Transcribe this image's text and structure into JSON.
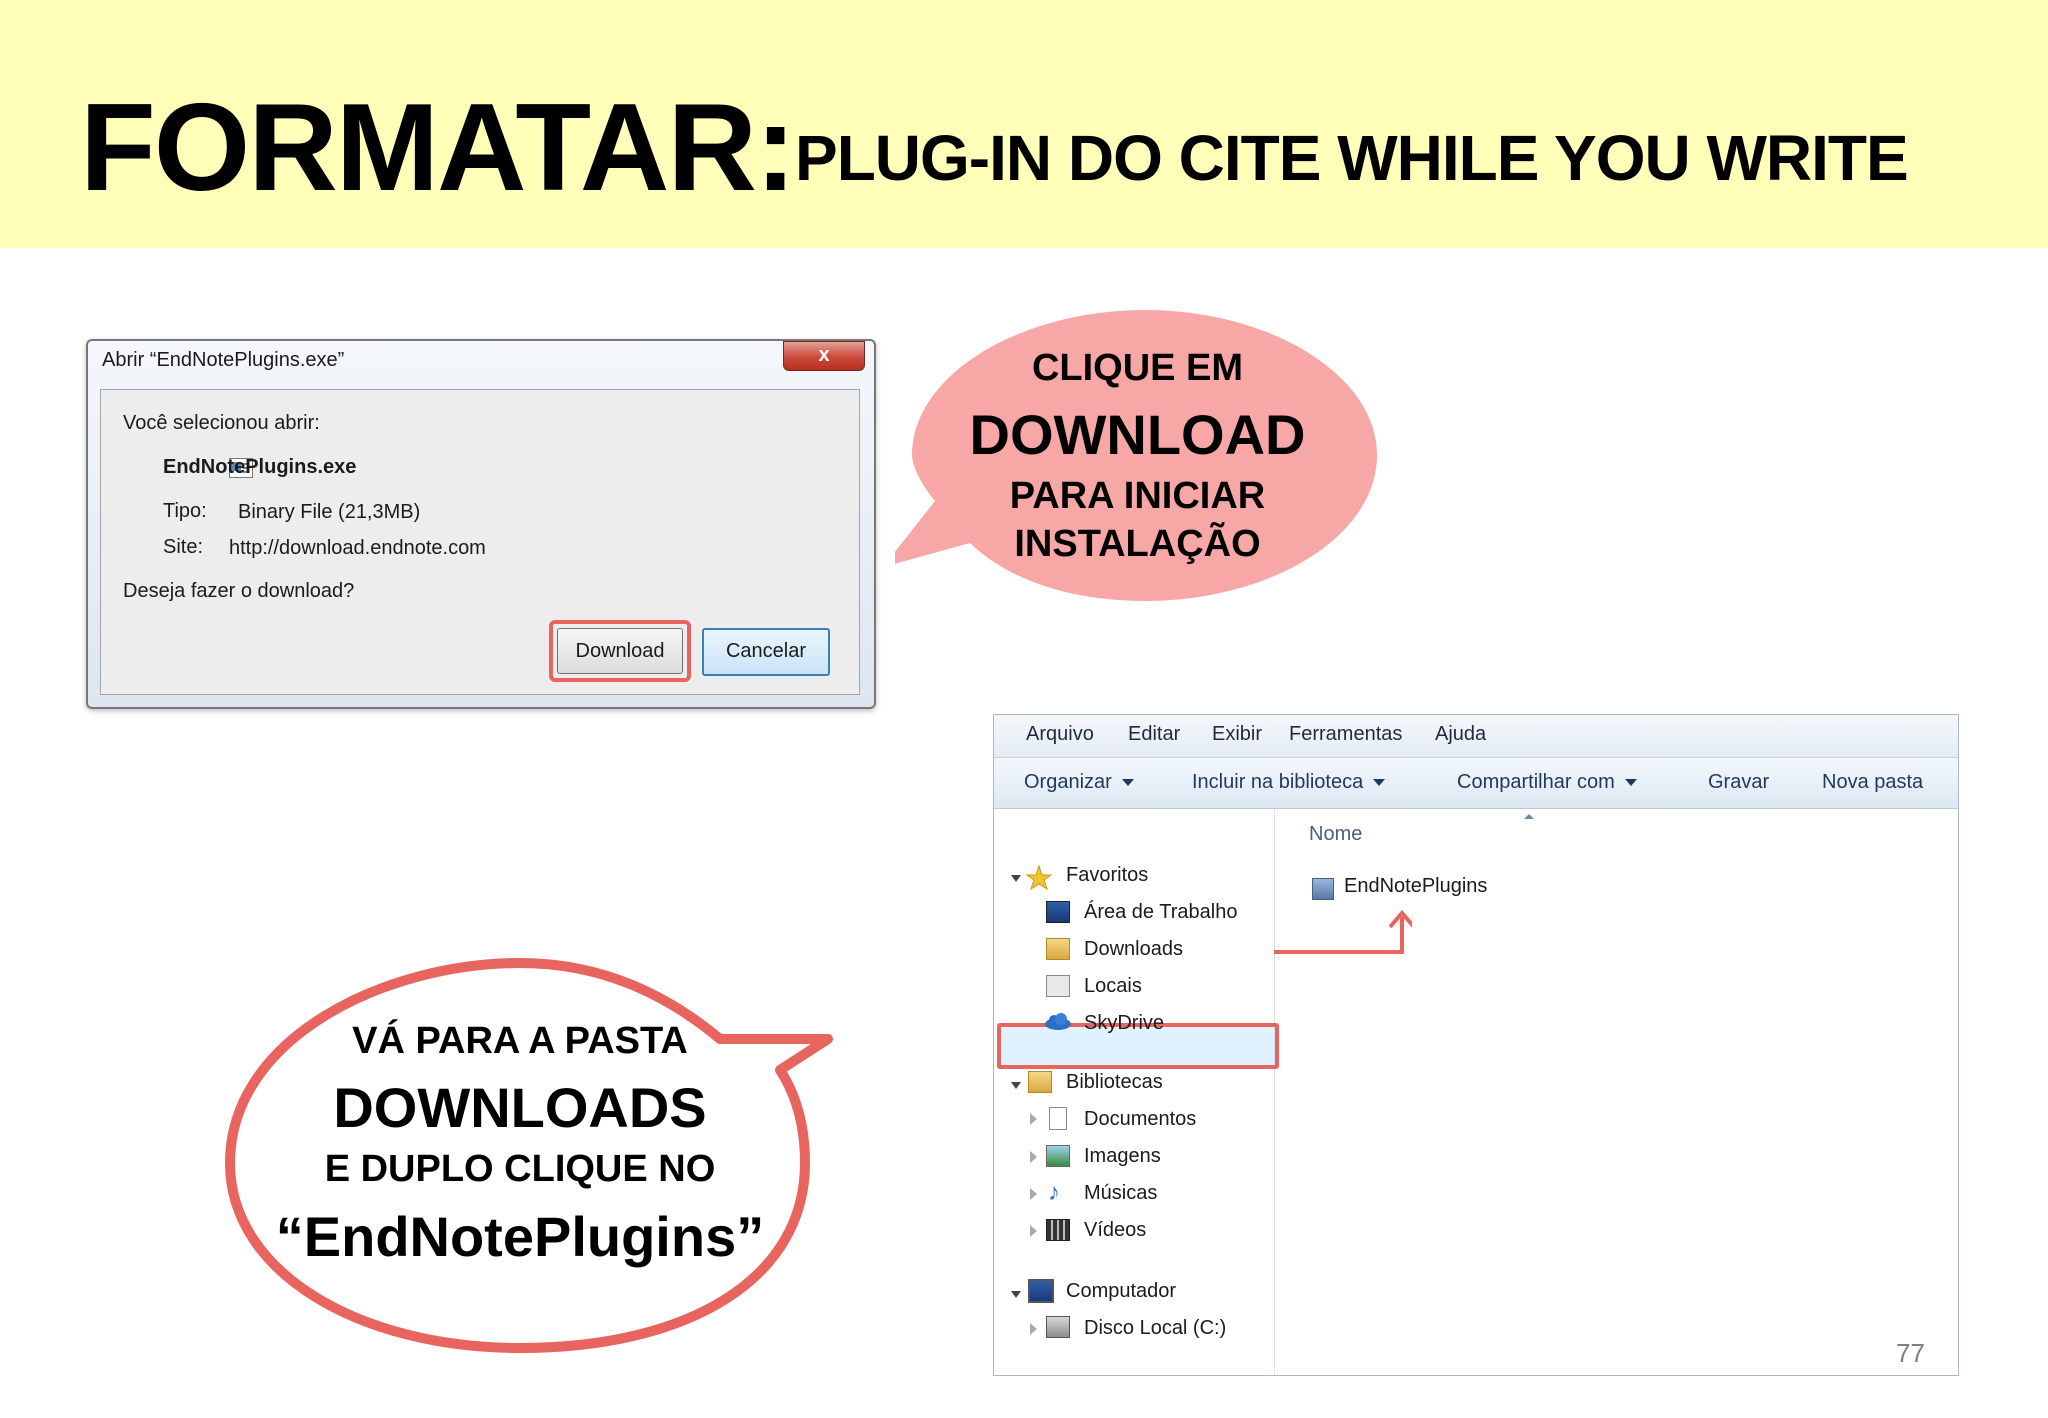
{
  "header": {
    "title": "FORMATAR:",
    "subtitle": "PLUG-IN DO CITE WHILE YOU WRITE"
  },
  "dialog": {
    "title": "Abrir “EndNotePlugins.exe”",
    "close_label": "x",
    "selected_label": "Você selecionou abrir:",
    "file_name": "EndNotePlugins.exe",
    "type_label": "Tipo:",
    "type_value": "Binary File (21,3MB)",
    "site_label": "Site:",
    "site_value": "http://download.endnote.com",
    "question": "Deseja fazer o download?",
    "download_button": "Download",
    "cancel_button": "Cancelar"
  },
  "bubble1": {
    "line1": "CLIQUE EM",
    "line2": "DOWNLOAD",
    "line3": "PARA INICIAR",
    "line4": "INSTALAÇÃO"
  },
  "bubble2": {
    "line1": "VÁ PARA A PASTA",
    "line2": "DOWNLOADS",
    "line3": "E DUPLO CLIQUE NO",
    "line4": "“EndNotePlugins”"
  },
  "explorer": {
    "menu": [
      "Arquivo",
      "Editar",
      "Exibir",
      "Ferramentas",
      "Ajuda"
    ],
    "toolbar": [
      "Organizar",
      "Incluir na biblioteca",
      "Compartilhar com",
      "Gravar",
      "Nova pasta"
    ],
    "column_header": "Nome",
    "file": "EndNotePlugins",
    "nav": {
      "favorites": "Favoritos",
      "desktop": "Área de Trabalho",
      "downloads": "Downloads",
      "locais": "Locais",
      "skydrive": "SkyDrive",
      "libraries": "Bibliotecas",
      "documents": "Documentos",
      "images": "Imagens",
      "music": "Músicas",
      "videos": "Vídeos",
      "computer": "Computador",
      "local_disk": "Disco Local (C:)"
    }
  },
  "page_number": "77",
  "colors": {
    "header_bg": "#ffffb9",
    "bubble1_fill": "#f8a7a7",
    "bubble2_stroke": "#e8645f",
    "highlight": "#e8645f"
  }
}
